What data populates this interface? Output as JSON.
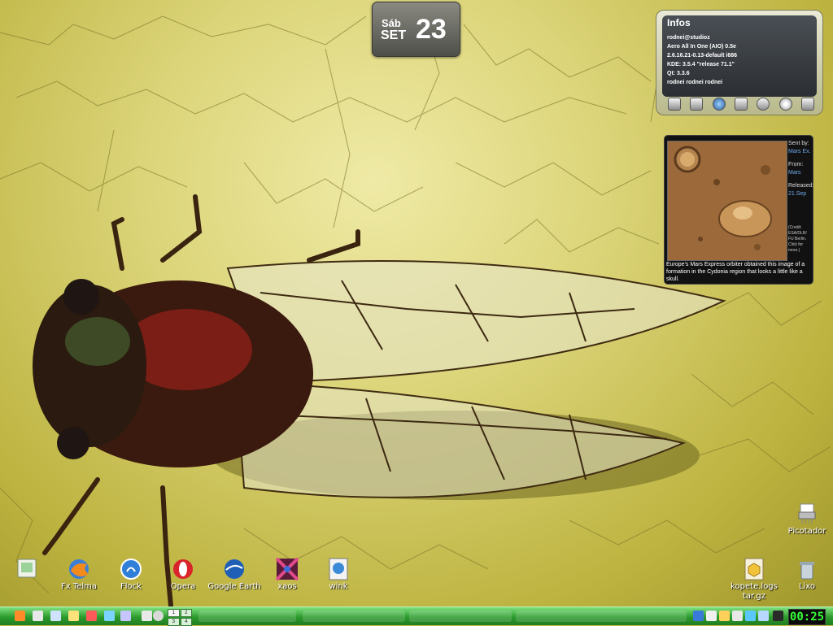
{
  "date_widget": {
    "day": "Sáb",
    "month": "SET",
    "date": "23"
  },
  "infos": {
    "title": "Infos",
    "lines": [
      "rodnei@studioz",
      "Aero All In One (AIO) 0.5e",
      "2.6.16.21-0.13-default i686",
      "KDE: 3.5.4 \"release 71.1\"",
      "Qt: 3.3.6",
      "rodnei rodnei rodnei"
    ],
    "icons": [
      "network-icon",
      "drive-icon",
      "globe-icon",
      "monitor-icon",
      "settings-icon",
      "disc-icon",
      "speaker-icon"
    ]
  },
  "mars": {
    "sent_by_label": "Sent by:",
    "sent_by": "Mars Ex.",
    "from_label": "From:",
    "from": "Mars",
    "released_label": "Released:",
    "released": "21.Sep",
    "credit": "(Credit: ESA/DLR/ FU Berlin. Click for more.)",
    "caption": "Europe's Mars Express orbiter obtained this image of a formation in the Cydonia region that looks a little like a skull."
  },
  "desktop_icons": [
    {
      "id": "unnamed",
      "label": ""
    },
    {
      "id": "fx-telma",
      "label": "Fx Telma"
    },
    {
      "id": "flock",
      "label": "Flock"
    },
    {
      "id": "opera",
      "label": "Opera"
    },
    {
      "id": "google-earth",
      "label": "Google Earth"
    },
    {
      "id": "xaos",
      "label": "xaos"
    },
    {
      "id": "wink",
      "label": "wink"
    },
    {
      "id": "kopete-logs",
      "label": "kopete.logs tar.gz"
    },
    {
      "id": "lixo",
      "label": "Lixo"
    },
    {
      "id": "picotador",
      "label": "Picotador"
    }
  ],
  "taskbar": {
    "pager": [
      "1",
      "2",
      "3",
      "4"
    ],
    "active_desktop": "1",
    "clock": "00:25",
    "colors": {
      "bar": "#2c9a2c",
      "clock_text": "#39ff39"
    }
  }
}
